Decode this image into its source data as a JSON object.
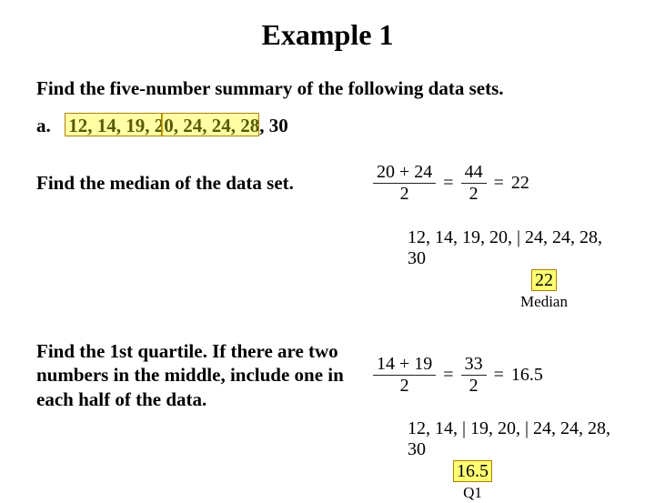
{
  "title": "Example 1",
  "prompt": "Find the five-number summary of the following data sets.",
  "part": {
    "label": "a.",
    "data": "12, 14, 19, 20, 24, 24, 28, 30"
  },
  "step1": {
    "text": "Find the median of the data set.",
    "frac1_num": "20 + 24",
    "frac1_den": "2",
    "frac2_num": "44",
    "frac2_den": "2",
    "result": "22",
    "listing": "12, 14, 19, 20, | 24, 24, 28, 30",
    "hl_value": "22",
    "hl_label": "Median"
  },
  "step2": {
    "text": "Find the 1st quartile. If there are two numbers in the middle, include one in each half of the data.",
    "frac1_num": "14 + 19",
    "frac1_den": "2",
    "frac2_num": "33",
    "frac2_den": "2",
    "result": "16.5",
    "listing": "12, 14, | 19, 20, | 24, 24, 28, 30",
    "hl_value": "16.5",
    "hl_label": "Q1"
  },
  "chart_data": {
    "type": "table",
    "title": "Five-number summary worked example (partial)",
    "dataset": [
      12,
      14,
      19,
      20,
      24,
      24,
      28,
      30
    ],
    "median": 22,
    "q1": 16.5
  }
}
